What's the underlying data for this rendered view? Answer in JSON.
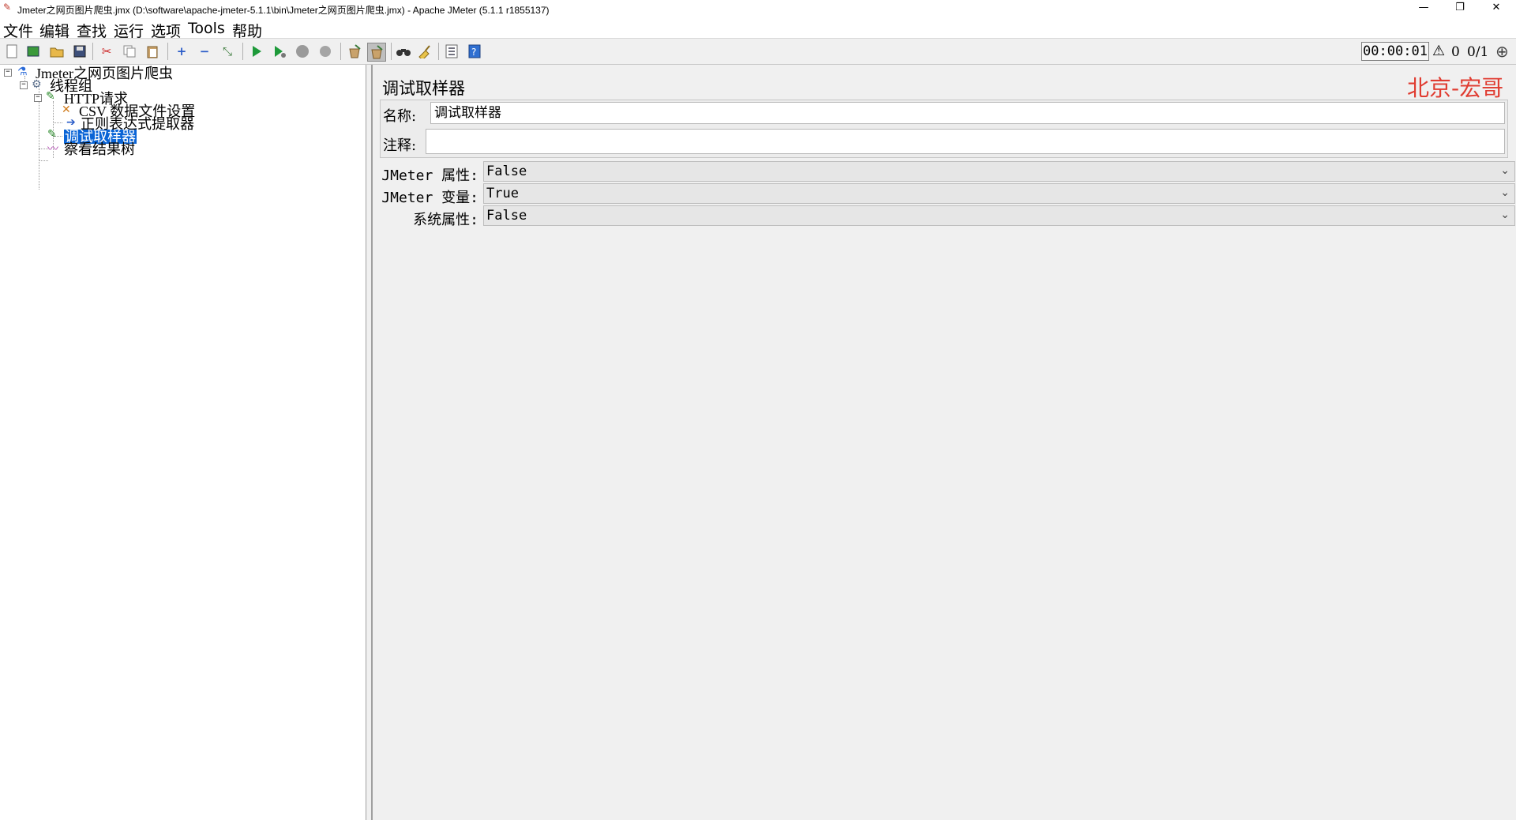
{
  "window": {
    "title": "Jmeter之网页图片爬虫.jmx (D:\\software\\apache-jmeter-5.1.1\\bin\\Jmeter之网页图片爬虫.jmx) - Apache JMeter (5.1.1 r1855137)",
    "minimize": "—",
    "restore": "❐",
    "close": "✕"
  },
  "menu": {
    "items": [
      {
        "label": "文件"
      },
      {
        "label": "编辑"
      },
      {
        "label": "查找"
      },
      {
        "label": "运行"
      },
      {
        "label": "选项"
      },
      {
        "label": "Tools"
      },
      {
        "label": "帮助"
      }
    ]
  },
  "toolbar": {
    "icons": [
      "new-file-icon",
      "templates-icon",
      "open-folder-icon",
      "save-icon",
      "cut-icon",
      "copy-icon",
      "paste-icon",
      "expand-icon",
      "collapse-icon",
      "toggle-icon",
      "start-icon",
      "start-no-pause-icon",
      "stop-icon",
      "shutdown-icon",
      "clear-icon",
      "clear-all-icon",
      "search-icon",
      "reset-search-icon",
      "function-helper-icon",
      "help-icon"
    ],
    "timer": "00:00:01",
    "warning_count": "0",
    "thread_count": "0/1"
  },
  "tree": {
    "nodes": [
      {
        "label": "Jmeter之网页图片爬虫",
        "icon": "test-plan-icon"
      },
      {
        "label": "线程组",
        "icon": "thread-group-gear-icon"
      },
      {
        "label": "HTTP请求",
        "icon": "http-sampler-pen-icon"
      },
      {
        "label": "CSV 数据文件设置",
        "icon": "csv-config-cross-icon"
      },
      {
        "label": "正则表达式提取器",
        "icon": "regex-extractor-arrow-icon"
      },
      {
        "label": "调试取样器",
        "icon": "debug-sampler-pen-icon",
        "selected": true
      },
      {
        "label": "察看结果树",
        "icon": "results-tree-chart-icon"
      }
    ]
  },
  "panel": {
    "title": "调试取样器",
    "watermark": "北京-宏哥",
    "name_label": "名称:",
    "name_value": "调试取样器",
    "comment_label": "注释:",
    "comment_value": "",
    "props": [
      {
        "label": "JMeter 属性:",
        "value": "False"
      },
      {
        "label": "JMeter 变量:",
        "value": "True"
      },
      {
        "label": "系统属性:",
        "value": "False"
      }
    ]
  },
  "colors": {
    "selection": "#0a64d6",
    "watermark": "#e03c31",
    "panel_bg": "#f0f0f0"
  }
}
